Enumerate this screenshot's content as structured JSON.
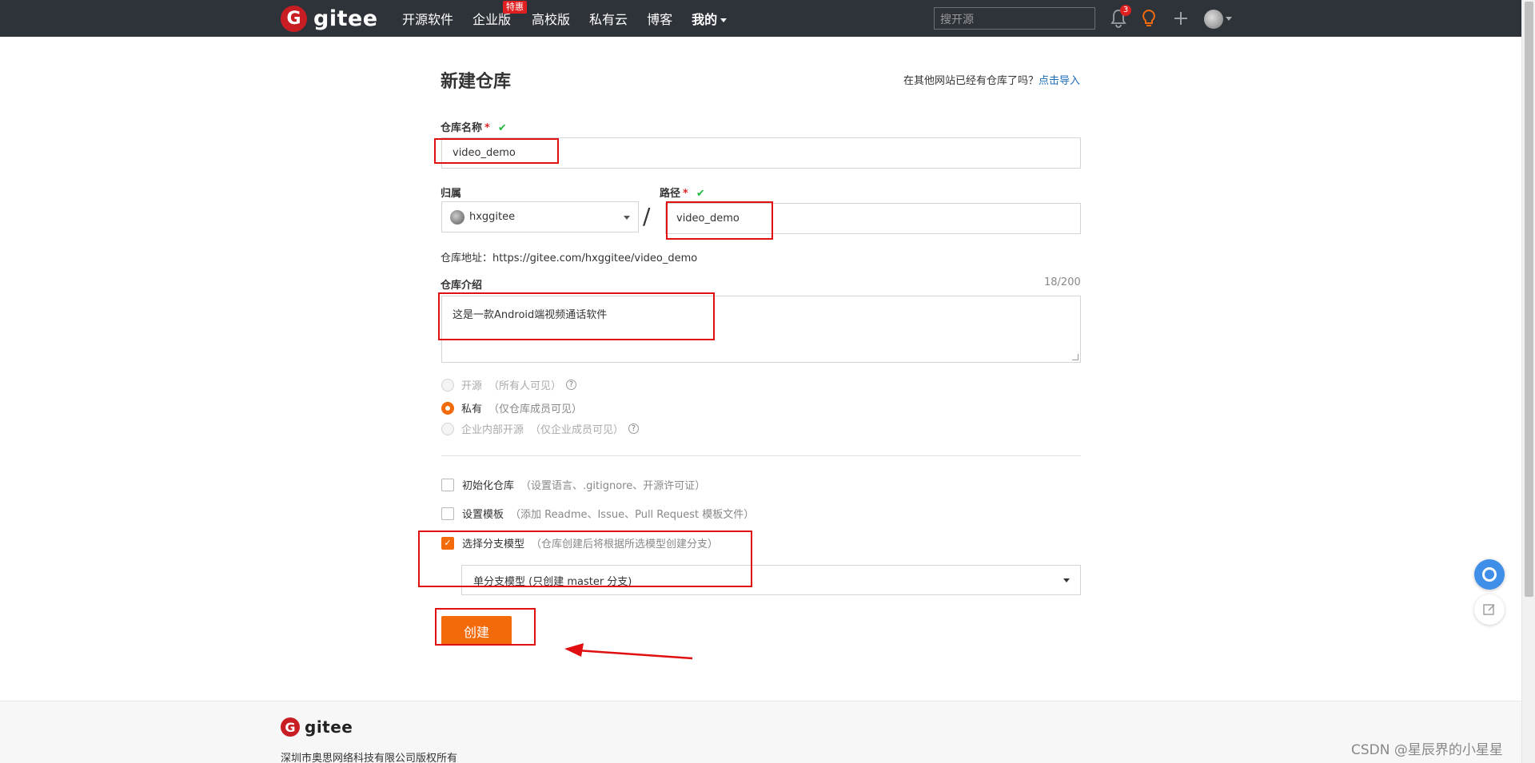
{
  "nav": {
    "logo_letter": "G",
    "logo_text": "gitee",
    "items": [
      {
        "label": "开源软件"
      },
      {
        "label": "企业版",
        "badge": "特惠"
      },
      {
        "label": "高校版"
      },
      {
        "label": "私有云"
      },
      {
        "label": "博客"
      },
      {
        "label": "我的"
      }
    ],
    "search_placeholder": "搜开源",
    "notification_count": "3"
  },
  "form": {
    "title": "新建仓库",
    "import_text": "在其他网站已经有仓库了吗？",
    "import_link": "点击导入",
    "repo_name_label": "仓库名称",
    "required_mark": "*",
    "check_mark": "✔",
    "repo_name_value": "video_demo",
    "owner_label": "归属",
    "owner_value": "hxggitee",
    "path_label": "路径",
    "path_value": "video_demo",
    "slash": "/",
    "repo_url_label": "仓库地址：",
    "repo_url": "https://gitee.com/hxggitee/video_demo",
    "desc_label": "仓库介绍",
    "desc_counter": "18/200",
    "desc_value": "这是一款Android端视频通话软件",
    "visibility": [
      {
        "label": "开源",
        "hint": "（所有人可见）",
        "selected": false,
        "disabled": true,
        "help": "?"
      },
      {
        "label": "私有",
        "hint": "（仅仓库成员可见）",
        "selected": true,
        "disabled": false
      },
      {
        "label": "企业内部开源",
        "hint": "（仅企业成员可见）",
        "selected": false,
        "disabled": true,
        "help": "?"
      }
    ],
    "options": [
      {
        "label": "初始化仓库",
        "hint": "（设置语言、.gitignore、开源许可证）",
        "checked": false
      },
      {
        "label": "设置模板",
        "hint": "（添加 Readme、Issue、Pull Request 模板文件）",
        "checked": false
      },
      {
        "label": "选择分支模型",
        "hint": "（仓库创建后将根据所选模型创建分支）",
        "checked": true
      }
    ],
    "branch_model_value": "单分支模型 (只创建 master 分支)",
    "submit_label": "创建"
  },
  "footer": {
    "logo_letter": "G",
    "logo_text": "gitee",
    "copyright": "深圳市奥思网络科技有限公司版权所有"
  },
  "watermark": "CSDN @星辰界的小星星",
  "colors": {
    "topbar": "#2e3239",
    "accent": "#f26a0a",
    "logo_red": "#c71d23",
    "link": "#1e6bb8",
    "annotation": "#e01010"
  }
}
